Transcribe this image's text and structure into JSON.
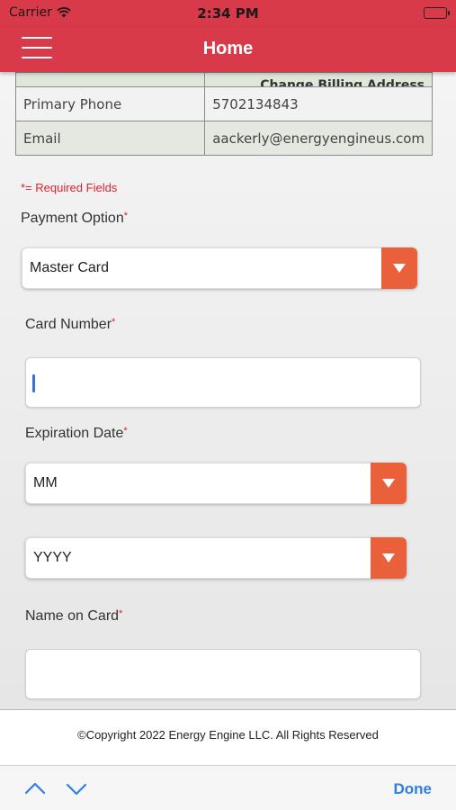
{
  "status_bar": {
    "carrier": "Carrier",
    "time": "2:34 PM"
  },
  "header": {
    "title": "Home"
  },
  "account_table": {
    "top_link": "Change Billing Address",
    "rows": [
      {
        "label": "Primary Phone",
        "value": "5702134843"
      },
      {
        "label": "Email",
        "value": "aackerly@energyengineus.com"
      }
    ]
  },
  "form": {
    "required_note": "*= Required Fields",
    "payment_option": {
      "label": "Payment Option",
      "value": "Master Card"
    },
    "card_number": {
      "label": "Card Number",
      "value": ""
    },
    "expiration": {
      "label": "Expiration Date",
      "month": "MM",
      "year": "YYYY"
    },
    "name_on_card": {
      "label": "Name on Card",
      "value": ""
    }
  },
  "footer": {
    "copyright": "©Copyright 2022 Energy Engine LLC. All Rights Reserved"
  },
  "keyboard_accessory": {
    "done_label": "Done"
  },
  "colors": {
    "header": "#d93a4a",
    "dropdown_accent": "#e9603a",
    "required": "#e0202f",
    "done": "#2f7ee8"
  }
}
